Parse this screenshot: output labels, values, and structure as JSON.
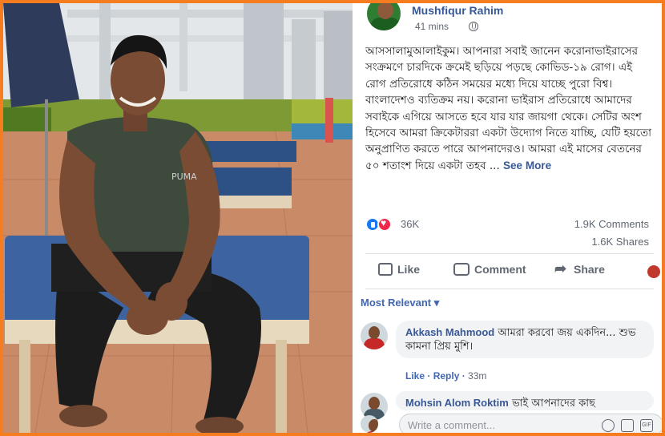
{
  "post": {
    "author": "Mushfiqur Rahim",
    "time": "41 mins",
    "text": "আসসালামুআলাইকুম। আপনারা সবাই জানেন করোনাভাইরাসের সংক্রমণে চারদিকে ক্রমেই ছড়িয়ে পড়ছে কোভিড-১৯ রোগ। এই রোগ প্রতিরোধে কঠিন সময়ের মধ্যে দিয়ে যাচ্ছে পুরো বিশ্ব। বাংলাদেশও ব্যতিক্রম নয়। করোনা ভাইরাস প্রতিরোধে আমাদের সবাইকে এগিয়ে আসতে হবে যার যার জায়গা থেকে। সেটির অংশ হিসেবে আমরা ক্রিকেটাররা একটা উদ্যোগ নিতে যাচ্ছি, যেটি হয়তো অনুপ্রাণিত করতে পারে আপনাদেরও। আমরা এই মাসের বেতনের ৫০ শতাংশ দিয়ে একটা তহব ...",
    "see_more": "See More"
  },
  "stats": {
    "reactions": "36K",
    "comments": "1.9K Comments",
    "shares": "1.6K Shares"
  },
  "actions": {
    "like": "Like",
    "comment": "Comment",
    "share": "Share"
  },
  "sort": "Most Relevant ▾",
  "comments": [
    {
      "name": "Akkash Mahmood",
      "text": "আমরা করবো জয় একদিন... শুভ কামনা প্রিয় মুশি।",
      "like": "Like",
      "reply": "Reply",
      "time": "33m"
    },
    {
      "name": "Mohsin Alom Roktim",
      "text": "ভাই আপনাদের কাছ"
    }
  ],
  "composer": {
    "placeholder": "Write a comment..."
  },
  "colors": {
    "frame": "#f57c1f",
    "link": "#385898"
  }
}
